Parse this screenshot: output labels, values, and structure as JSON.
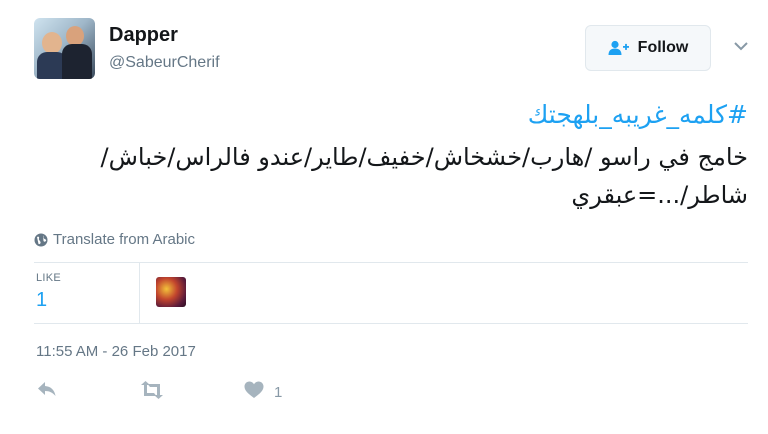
{
  "user": {
    "name": "Dapper",
    "handle": "@SabeurCherif"
  },
  "follow_button": {
    "label": "Follow"
  },
  "tweet": {
    "hashtag": "#كلمه_غريبه_بلهجتك",
    "text": "خامج في راسو /هارب/خشخاش/خفيف/طاير/عندو فالراس/خباش/شاطر/...=عبقري"
  },
  "translate": {
    "label": "Translate from Arabic"
  },
  "stats": {
    "like_label": "LIKE",
    "like_count": "1"
  },
  "timestamp": "11:55 AM - 26 Feb 2017",
  "actions": {
    "like_count": "1"
  },
  "colors": {
    "accent": "#1da1f2",
    "muted": "#657786",
    "divider": "#e1e8ed"
  }
}
